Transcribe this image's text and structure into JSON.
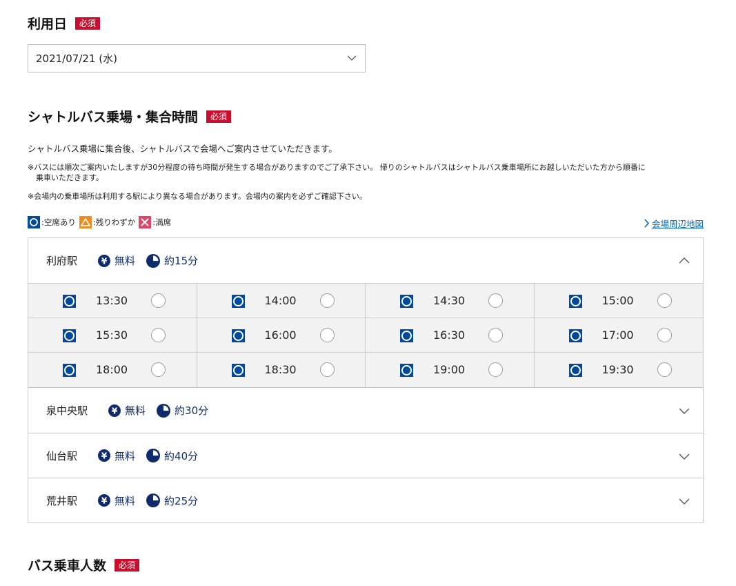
{
  "date_section": {
    "title": "利用日",
    "required": "必須",
    "selected_value": "2021/07/21 (水)"
  },
  "shuttle_section": {
    "title": "シャトルバス乗場・集合時間",
    "required": "必須",
    "description": "シャトルバス乗場に集合後、シャトルバスで会場へご案内させていただきます。",
    "note1_line1": "※バスには順次ご案内いたしますが30分程度の待ち時間が発生する場合がありますのでご了承下さい。 帰りのシャトルバスはシャトルバス乗車場所にお越しいただいた方から順番に",
    "note1_line2": "乗車いただきます。",
    "note2": "※会場内の乗車場所は利用する駅により異なる場合があります。会場内の案内を必ずご確認下さい。",
    "legend": {
      "available": ":空席あり",
      "few": ":残りわずか",
      "full": ":満席"
    },
    "map_link": "会場周辺地図",
    "stations": [
      {
        "name": "利府駅",
        "fare": "無料",
        "duration": "約15分",
        "expanded": true,
        "times": [
          "13:30",
          "14:00",
          "14:30",
          "15:00",
          "15:30",
          "16:00",
          "16:30",
          "17:00",
          "18:00",
          "18:30",
          "19:00",
          "19:30"
        ]
      },
      {
        "name": "泉中央駅",
        "fare": "無料",
        "duration": "約30分",
        "expanded": false
      },
      {
        "name": "仙台駅",
        "fare": "無料",
        "duration": "約40分",
        "expanded": false
      },
      {
        "name": "荒井駅",
        "fare": "無料",
        "duration": "約25分",
        "expanded": false
      }
    ]
  },
  "passenger_section": {
    "title": "バス乗車人数",
    "required": "必須"
  },
  "colors": {
    "navy": "#0f2b6b",
    "status_blue": "#004a99",
    "required_red": "#c8102e",
    "link_blue": "#0068b7",
    "few_orange": "#f08c1e",
    "full_red": "#e0466a"
  }
}
